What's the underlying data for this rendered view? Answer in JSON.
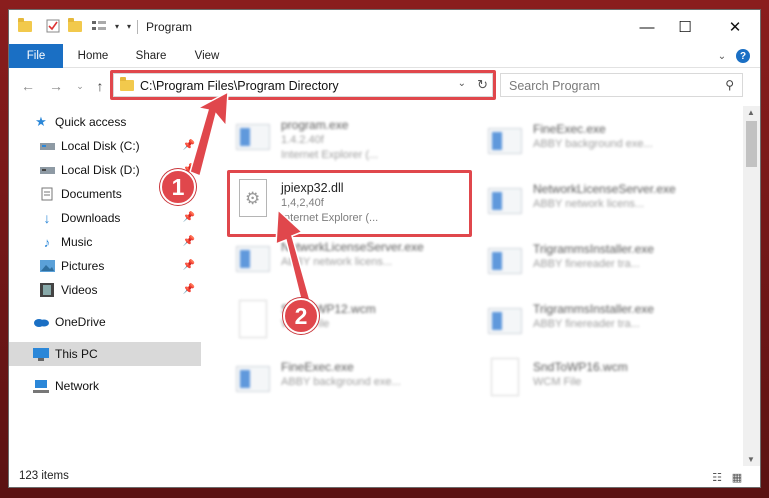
{
  "window": {
    "title": "Program",
    "controls": {
      "minimize": "—",
      "maximize": "☐",
      "close": "✕"
    }
  },
  "ribbon": {
    "tabs": [
      "File",
      "Home",
      "Share",
      "View"
    ],
    "help": "?"
  },
  "address": {
    "path": "C:\\Program Files\\Program Directory"
  },
  "search": {
    "placeholder": "Search Program"
  },
  "sidebar": {
    "items": [
      {
        "label": "Quick access",
        "icon": "star-icon",
        "pinned": false
      },
      {
        "label": "Local Disk (C:)",
        "icon": "drive-icon",
        "pinned": true
      },
      {
        "label": "Local Disk (D:)",
        "icon": "drive-icon",
        "pinned": true
      },
      {
        "label": "Documents",
        "icon": "documents-icon",
        "pinned": true
      },
      {
        "label": "Downloads",
        "icon": "download-icon",
        "pinned": true
      },
      {
        "label": "Music",
        "icon": "music-icon",
        "pinned": true
      },
      {
        "label": "Pictures",
        "icon": "pictures-icon",
        "pinned": true
      },
      {
        "label": "Videos",
        "icon": "videos-icon",
        "pinned": true
      },
      {
        "label": "OneDrive",
        "icon": "cloud-icon",
        "pinned": false
      },
      {
        "label": "This PC",
        "icon": "computer-icon",
        "pinned": false,
        "selected": true
      },
      {
        "label": "Network",
        "icon": "network-icon",
        "pinned": false
      }
    ]
  },
  "files": {
    "left": [
      {
        "name": "program.exe",
        "line1": "1.4.2.40f",
        "line2": "Internet Explorer (..."
      },
      {
        "name": "jpiexp32.dll",
        "line1": "1,4,2,40f",
        "line2": "Internet Explorer (..."
      },
      {
        "name": "NetworkLicenseServer.exe",
        "line1": "ABBY network licens..."
      },
      {
        "name": "SndToWP12.wcm",
        "line1": "WCM File"
      },
      {
        "name": "FineExec.exe",
        "line1": "ABBY background exe..."
      }
    ],
    "right": [
      {
        "name": "FineExec.exe",
        "line1": "ABBY background exe..."
      },
      {
        "name": "NetworkLicenseServer.exe",
        "line1": "ABBY network licens..."
      },
      {
        "name": "TrigrammsInstaller.exe",
        "line1": "ABBY finereader tra..."
      },
      {
        "name": "TrigrammsInstaller.exe",
        "line1": "ABBY finereader tra..."
      },
      {
        "name": "SndToWP16.wcm",
        "line1": "WCM File"
      }
    ]
  },
  "status": {
    "count": "123 items"
  },
  "annotations": {
    "step1": "1",
    "step2": "2",
    "color": "#e0474c"
  }
}
